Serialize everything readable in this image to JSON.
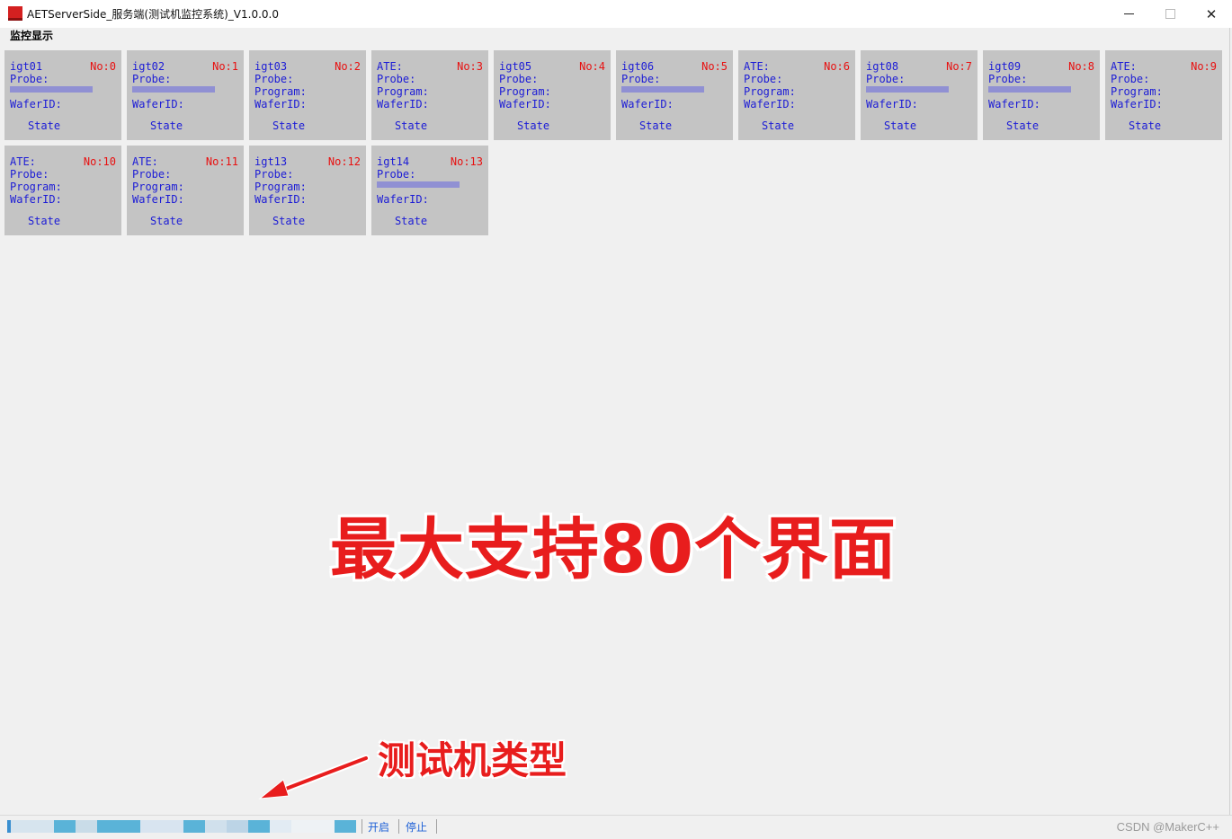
{
  "window": {
    "title": "AETServerSide_服务端(测试机监控系统)_V1.0.0.0",
    "controls": {
      "minimize": "—",
      "maximize": "□",
      "close": "✕"
    }
  },
  "menu": {
    "items": [
      "监控显示"
    ]
  },
  "labels": {
    "probe": "Probe:",
    "program": "Program:",
    "waferid": "WaferID:",
    "state": "State"
  },
  "cards": [
    {
      "name": "igt01",
      "no": "No:0",
      "show_program": false,
      "blurred": true
    },
    {
      "name": "igt02",
      "no": "No:1",
      "show_program": false,
      "blurred": true
    },
    {
      "name": "igt03",
      "no": "No:2",
      "show_program": true,
      "blurred": false
    },
    {
      "name": "ATE:",
      "no": "No:3",
      "show_program": true,
      "blurred": false
    },
    {
      "name": "igt05",
      "no": "No:4",
      "show_program": true,
      "blurred": false
    },
    {
      "name": "igt06",
      "no": "No:5",
      "show_program": false,
      "blurred": true
    },
    {
      "name": "ATE:",
      "no": "No:6",
      "show_program": true,
      "blurred": false
    },
    {
      "name": "igt08",
      "no": "No:7",
      "show_program": false,
      "blurred": true
    },
    {
      "name": "igt09",
      "no": "No:8",
      "show_program": false,
      "blurred": true
    },
    {
      "name": "ATE:",
      "no": "No:9",
      "show_program": true,
      "blurred": false
    },
    {
      "name": "ATE:",
      "no": "No:10",
      "show_program": true,
      "blurred": false
    },
    {
      "name": "ATE:",
      "no": "No:11",
      "show_program": true,
      "blurred": false
    },
    {
      "name": "igt13",
      "no": "No:12",
      "show_program": true,
      "blurred": false
    },
    {
      "name": "igt14",
      "no": "No:13",
      "show_program": false,
      "blurred": true
    }
  ],
  "overlay": {
    "banner": "最大支持80个界面",
    "annotation": "测试机类型"
  },
  "statusbar": {
    "start_label": "开启",
    "stop_label": "停止",
    "watermark": "CSDN @MakerC++"
  },
  "colors": {
    "card_bg": "#c4c4c4",
    "card_text": "#1c1cd6",
    "card_no": "#e81010",
    "overlay_red": "#e81d1d"
  }
}
